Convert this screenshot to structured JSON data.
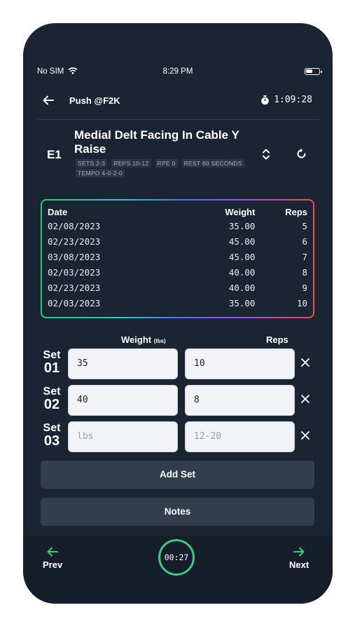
{
  "status_bar": {
    "carrier": "No SIM",
    "time": "8:29 PM",
    "battery_level": 0.45
  },
  "header": {
    "back_icon": "arrow-left-icon",
    "title": "Push @F2K",
    "stopwatch_icon": "stopwatch-icon",
    "elapsed": "1:09:28"
  },
  "exercise": {
    "code": "E1",
    "name": "Medial Delt Facing In Cable Y Raise",
    "tags": [
      "SETS 2-3",
      "REPS 10-12",
      "RPE 0",
      "REST 60 SECONDS",
      "TEMPO 4-0-2-0"
    ],
    "reorder_icon": "chevron-up-down-icon",
    "swap_icon": "refresh-icon"
  },
  "history": {
    "headers": {
      "date": "Date",
      "weight": "Weight",
      "reps": "Reps"
    },
    "rows": [
      {
        "date": "02/08/2023",
        "weight": "35.00",
        "reps": "5"
      },
      {
        "date": "02/23/2023",
        "weight": "45.00",
        "reps": "6"
      },
      {
        "date": "03/08/2023",
        "weight": "45.00",
        "reps": "7"
      },
      {
        "date": "02/03/2023",
        "weight": "40.00",
        "reps": "8"
      },
      {
        "date": "02/23/2023",
        "weight": "40.00",
        "reps": "9"
      },
      {
        "date": "02/03/2023",
        "weight": "35.00",
        "reps": "10"
      }
    ],
    "border_gradient": [
      "#25d07a",
      "#4d6ff0",
      "#f04a4a"
    ]
  },
  "sets": {
    "weight_header": "Weight",
    "weight_unit": "(lbs)",
    "reps_header": "Reps",
    "set_word": "Set",
    "items": [
      {
        "number": "01",
        "weight": "35",
        "reps": "10"
      },
      {
        "number": "02",
        "weight": "40",
        "reps": "8"
      },
      {
        "number": "03",
        "weight_placeholder": "lbs",
        "reps_placeholder": "12-20"
      }
    ],
    "remove_icon": "close-icon"
  },
  "actions": {
    "add_set": "Add Set",
    "notes": "Notes"
  },
  "footer": {
    "prev_label": "Prev",
    "next_label": "Next",
    "prev_icon": "arrow-left-icon",
    "next_icon": "arrow-right-icon",
    "rest_timer": "00:27",
    "accent": "#35d07f"
  }
}
